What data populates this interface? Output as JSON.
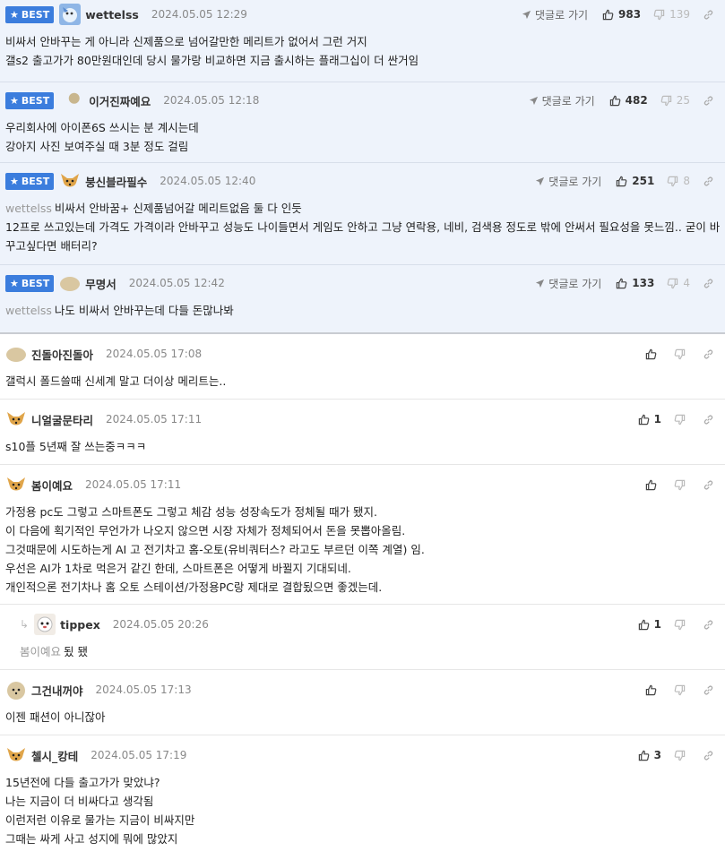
{
  "labels": {
    "best": "BEST",
    "reply_go": "댓글로 가기"
  },
  "comments": [
    {
      "best": true,
      "nick": "wettelss",
      "date": "2024.05.05 12:29",
      "up": "983",
      "down": "139",
      "lines": [
        "비싸서 안바꾸는 게 아니라 신제품으로 넘어갈만한 메리트가 없어서 그런 거지",
        "갤s2 출고가가 80만원대인데 당시 물가랑 비교하면 지금 출시하는 플래그십이 더 싼거임"
      ]
    },
    {
      "best": true,
      "nick": "이거진짜예요",
      "date": "2024.05.05 12:18",
      "up": "482",
      "down": "25",
      "lines": [
        "우리회사에 아이폰6S 쓰시는 분 계시는데",
        "강아지 사진 보여주실 때 3분 정도 걸림"
      ]
    },
    {
      "best": true,
      "nick": "붕신블라필수",
      "date": "2024.05.05 12:40",
      "up": "251",
      "down": "8",
      "mention": "wettelss",
      "lines": [
        "비싸서 안바꿈+ 신제품넘어갈 메리트없음 둘 다 인듯",
        "12프로 쓰고있는데 가격도 가격이라 안바꾸고 성능도 나이들면서 게임도 안하고 그냥 연락용, 네비, 검색용 정도로 밖에 안써서 필요성을 못느낌.. 굳이 바꾸고싶다면 배터리?"
      ]
    },
    {
      "best": true,
      "nick": "무명서",
      "date": "2024.05.05 12:42",
      "up": "133",
      "down": "4",
      "mention": "wettelss",
      "lines": [
        "나도 비싸서 안바꾸는데 다들 돈많나봐"
      ]
    },
    {
      "best": false,
      "nick": "진돌아진돌아",
      "date": "2024.05.05 17:08",
      "up": "",
      "down": "",
      "lines": [
        "갤럭시 폴드쓸때 신세계 말고 더이상 메리트는.."
      ]
    },
    {
      "best": false,
      "nick": "니얼굴문타리",
      "date": "2024.05.05 17:11",
      "up": "1",
      "down": "",
      "lines": [
        "s10플 5년째 잘 쓰는중ㅋㅋㅋ"
      ]
    },
    {
      "best": false,
      "nick": "봄이예요",
      "date": "2024.05.05 17:11",
      "up": "",
      "down": "",
      "lines": [
        "가정용 pc도 그렇고 스마트폰도 그렇고 체감 성능 성장속도가 정체될 때가 됐지.",
        "이 다음에 획기적인 무언가가 나오지 않으면 시장 자체가 정체되어서 돈을 못뽑아올림.",
        "그것때문에 시도하는게 AI 고 전기차고 홈-오토(유비쿼터스? 라고도 부르던 이쪽 계열) 임.",
        "우선은 AI가 1차로 먹은거 같긴 한데, 스마트폰은 어떻게 바뀔지 기대되네.",
        "개인적으론 전기차나 홈 오토 스테이션/가정용PC랑 제대로 결합됬으면 좋겠는데."
      ]
    },
    {
      "best": false,
      "reply": true,
      "nick": "tippex",
      "date": "2024.05.05 20:26",
      "up": "1",
      "down": "",
      "mention": "봄이예요",
      "lines": [
        "됬 됐"
      ]
    },
    {
      "best": false,
      "nick": "그건내꺼야",
      "date": "2024.05.05 17:13",
      "up": "",
      "down": "",
      "lines": [
        "이젠 패션이 아니잖아"
      ]
    },
    {
      "best": false,
      "nick": "첼시_캉테",
      "date": "2024.05.05 17:19",
      "up": "3",
      "down": "",
      "lines": [
        "15년전에 다들 출고가가 맞았냐?",
        "나는 지금이 더 비싸다고 생각됨",
        "이런저런 이유로 물가는 지금이 비싸지만",
        "그때는 싸게 사고 성지에 뭐에 많았지"
      ]
    }
  ]
}
